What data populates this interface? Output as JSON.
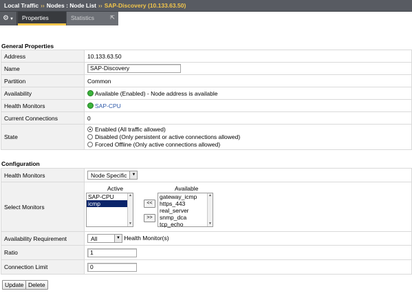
{
  "breadcrumb": {
    "part1": "Local Traffic",
    "sep": "››",
    "part2": "Nodes : Node List",
    "current": "SAP-Discovery (10.133.63.50)"
  },
  "tabs": {
    "properties": "Properties",
    "statistics": "Statistics"
  },
  "general": {
    "title": "General Properties",
    "address_label": "Address",
    "address_value": "10.133.63.50",
    "name_label": "Name",
    "name_value": "SAP-Discovery",
    "partition_label": "Partition",
    "partition_value": "Common",
    "availability_label": "Availability",
    "availability_value": "Available (Enabled) - Node address is available",
    "health_label": "Health Monitors",
    "health_value": "SAP-CPU",
    "connections_label": "Current Connections",
    "connections_value": "0",
    "state_label": "State",
    "state_options": [
      "Enabled (All traffic allowed)",
      "Disabled (Only persistent or active connections allowed)",
      "Forced Offline (Only active connections allowed)"
    ]
  },
  "config": {
    "title": "Configuration",
    "health_label": "Health Monitors",
    "health_select": "Node Specific",
    "select_label": "Select Monitors",
    "active_head": "Active",
    "available_head": "Available",
    "active_items": [
      "SAP-CPU",
      "icmp"
    ],
    "available_items": [
      "gateway_icmp",
      "https_443",
      "real_server",
      "snmp_dca",
      "tcp_echo"
    ],
    "move_left": "<<",
    "move_right": ">>",
    "avail_req_label": "Availability Requirement",
    "avail_req_select": "All",
    "avail_req_suffix": "Health Monitor(s)",
    "ratio_label": "Ratio",
    "ratio_value": "1",
    "conn_limit_label": "Connection Limit",
    "conn_limit_value": "0"
  },
  "buttons": {
    "update": "Update",
    "delete": "Delete"
  },
  "colors": {
    "header_bg": "#585b62",
    "accent": "#f3c64b",
    "status_green": "#3cb43c",
    "link": "#2b57a8",
    "selected_bg": "#0a246a"
  }
}
